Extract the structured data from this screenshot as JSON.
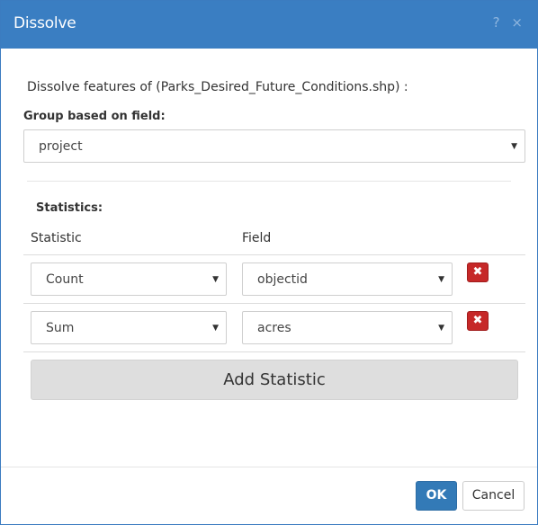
{
  "dialog": {
    "title": "Dissolve",
    "help_icon": "?",
    "close_icon": "×"
  },
  "description": "Dissolve features of (Parks_Desired_Future_Conditions.shp) :",
  "group": {
    "label": "Group based on field:",
    "selected": "project"
  },
  "statistics": {
    "label": "Statistics:",
    "col_statistic": "Statistic",
    "col_field": "Field",
    "rows": [
      {
        "statistic": "Count",
        "field": "objectid"
      },
      {
        "statistic": "Sum",
        "field": "acres"
      }
    ],
    "delete_icon": "✖",
    "add_label": "Add Statistic"
  },
  "footer": {
    "ok_label": "OK",
    "cancel_label": "Cancel"
  },
  "icons": {
    "help": "question-icon",
    "close": "close-icon",
    "caret": "caret-down-icon",
    "delete": "delete-icon"
  },
  "colors": {
    "titlebar": "#3a7ec2",
    "primary": "#337ab7",
    "danger": "#c62828"
  }
}
